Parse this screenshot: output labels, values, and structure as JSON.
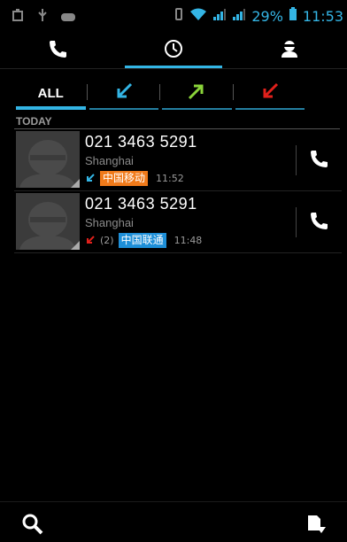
{
  "status_bar": {
    "battery_text": "29%",
    "time": "11:53",
    "icons": [
      "usb-icon",
      "android-icon",
      "game-icon",
      "vibrate-icon",
      "wifi-icon",
      "signal-icon",
      "signal-icon-2",
      "battery-icon"
    ]
  },
  "top_tabs": [
    {
      "name": "phone",
      "icon": "phone-icon"
    },
    {
      "name": "call-log",
      "icon": "clock-icon",
      "active": true
    },
    {
      "name": "contacts",
      "icon": "person-icon"
    }
  ],
  "filter_tabs": {
    "all_label": "ALL",
    "items": [
      "all",
      "incoming",
      "outgoing",
      "missed"
    ]
  },
  "section": {
    "title": "TODAY"
  },
  "calls": [
    {
      "number": "021 3463 5291",
      "location": "Shanghai",
      "type": "incoming",
      "count": "",
      "sim": "中国移动",
      "time": "11:52"
    },
    {
      "number": "021 3463 5291",
      "location": "Shanghai",
      "type": "missed",
      "count": "(2)",
      "sim": "中国联通",
      "time": "11:48"
    }
  ],
  "colors": {
    "accent": "#33b5e5",
    "incoming": "#33b5e5",
    "outgoing": "#8ad43a",
    "missed": "#e0201b",
    "sim_mobile": "#f07a1a",
    "sim_unicom": "#1e8fd8"
  }
}
